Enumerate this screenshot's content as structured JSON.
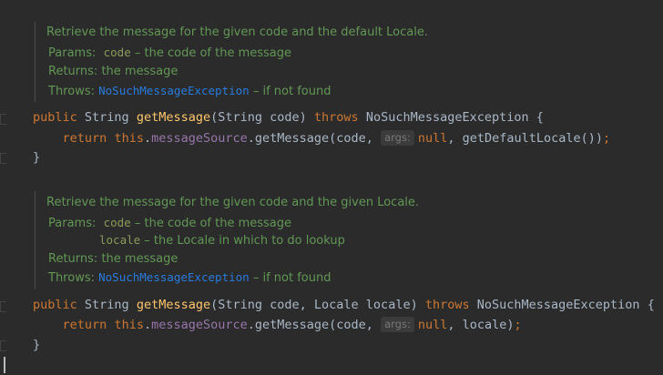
{
  "colors": {
    "background": "#2b2b2b",
    "doc_text": "#629755",
    "doc_link": "#287bde",
    "keyword": "#cc7832",
    "method_decl": "#ffc66d",
    "field": "#9876aa",
    "default_text": "#a9b7c6",
    "hint_bg": "#3b3b3b",
    "hint_text": "#787878"
  },
  "methods": [
    {
      "doc": {
        "summary": "Retrieve the message for the given code and the default Locale.",
        "params_label": "Params:",
        "params": [
          {
            "name": "code",
            "desc": "– the code of the message"
          }
        ],
        "returns_label": "Returns:",
        "returns": "the message",
        "throws_label": "Throws:",
        "throws_name": "NoSuchMessageException",
        "throws_desc": "– if not found"
      },
      "decl": {
        "modifier": "public",
        "return_type": "String",
        "name": "getMessage",
        "params_text": "(String code) ",
        "throws_kw": "throws",
        "exception": "NoSuchMessageException",
        "open": "{"
      },
      "body": {
        "return_kw": "return",
        "this_kw": "this",
        "dot1": ".",
        "field": "messageSource",
        "call": ".getMessage(code, ",
        "hint": "args:",
        "null_kw": "null",
        "rest": ", getDefaultLocale())",
        "semicolon": ";"
      },
      "close": "}"
    },
    {
      "doc": {
        "summary": "Retrieve the message for the given code and the given Locale.",
        "params_label": "Params:",
        "params": [
          {
            "name": "code",
            "desc": "– the code of the message"
          },
          {
            "name": "locale",
            "desc": "– the Locale in which to do lookup"
          }
        ],
        "returns_label": "Returns:",
        "returns": "the message",
        "throws_label": "Throws:",
        "throws_name": "NoSuchMessageException",
        "throws_desc": "– if not found"
      },
      "decl": {
        "modifier": "public",
        "return_type": "String",
        "name": "getMessage",
        "params_text": "(String code, Locale locale) ",
        "throws_kw": "throws",
        "exception": "NoSuchMessageException",
        "open": "{"
      },
      "body": {
        "return_kw": "return",
        "this_kw": "this",
        "dot1": ".",
        "field": "messageSource",
        "call": ".getMessage(code, ",
        "hint": "args:",
        "null_kw": "null",
        "rest": ", locale)",
        "semicolon": ";"
      },
      "close": "}"
    }
  ]
}
